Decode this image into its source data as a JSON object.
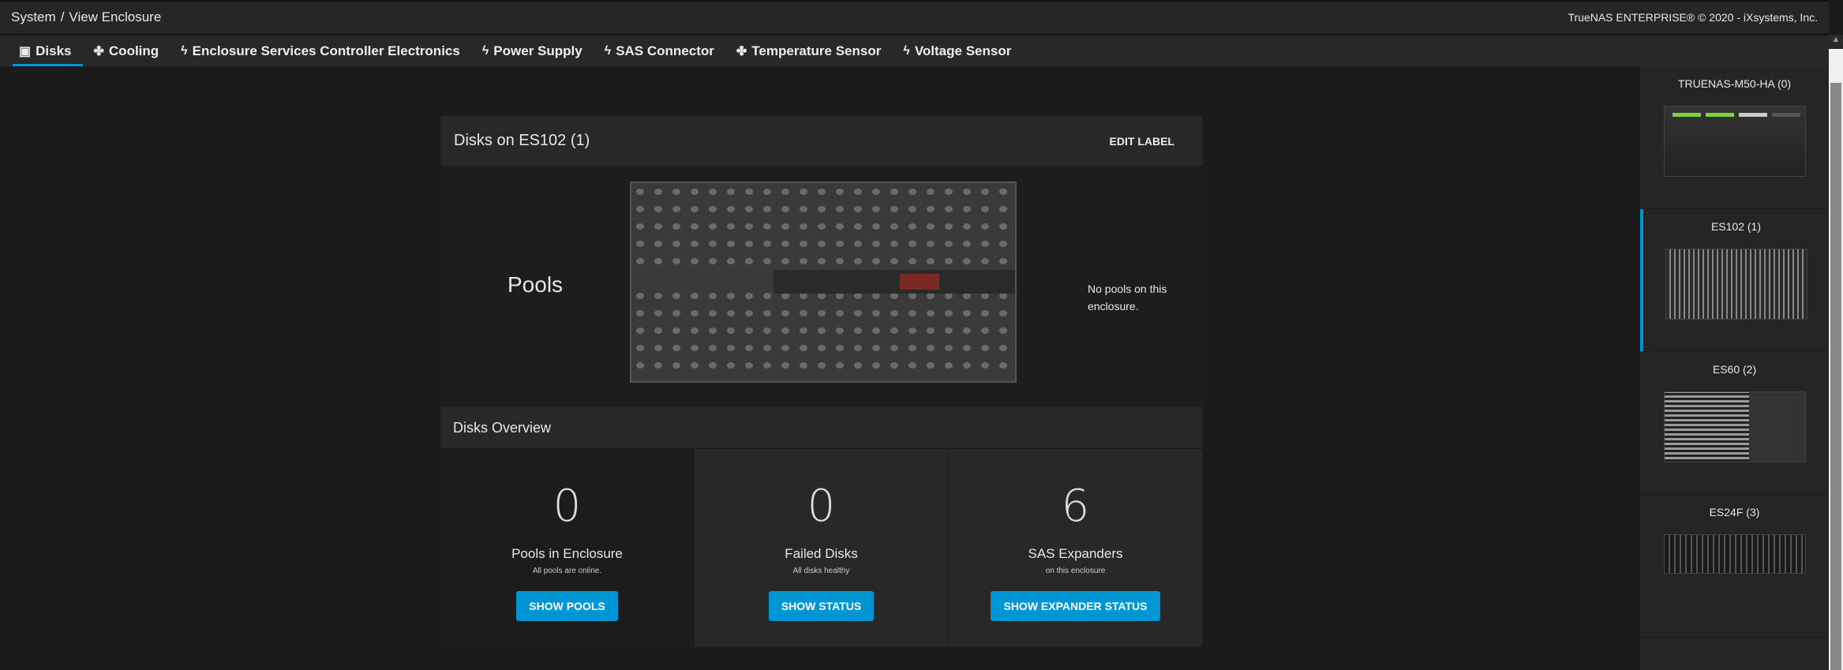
{
  "header": {
    "breadcrumb": [
      "System",
      "View Enclosure"
    ],
    "copyright": "TrueNAS ENTERPRISE® © 2020 - iXsystems, Inc."
  },
  "tabs": [
    {
      "label": "Disks",
      "icon": "disk-icon"
    },
    {
      "label": "Cooling",
      "icon": "fan-icon"
    },
    {
      "label": "Enclosure Services Controller Electronics",
      "icon": "bolt-icon"
    },
    {
      "label": "Power Supply",
      "icon": "bolt-icon"
    },
    {
      "label": "SAS Connector",
      "icon": "bolt-icon"
    },
    {
      "label": "Temperature Sensor",
      "icon": "fan-icon"
    },
    {
      "label": "Voltage Sensor",
      "icon": "bolt-icon"
    }
  ],
  "card": {
    "title": "Disks on ES102 (1)",
    "edit_label": "EDIT LABEL",
    "pools_title": "Pools",
    "no_pools": "No pools on this enclosure.",
    "overview_title": "Disks Overview",
    "stats": [
      {
        "value": "0",
        "label": "Pools in Enclosure",
        "sub": "All pools are online.",
        "button": "SHOW POOLS"
      },
      {
        "value": "0",
        "label": "Failed Disks",
        "sub": "All disks healthy",
        "button": "SHOW STATUS"
      },
      {
        "value": "6",
        "label": "SAS Expanders",
        "sub": "on this enclosure",
        "button": "SHOW EXPANDER STATUS"
      }
    ]
  },
  "sidebar": {
    "items": [
      {
        "label": "TRUENAS-M50-HA (0)"
      },
      {
        "label": "ES102 (1)",
        "selected": true
      },
      {
        "label": "ES60 (2)"
      },
      {
        "label": "ES24F (3)"
      }
    ]
  },
  "colors": {
    "accent": "#0095d5"
  }
}
